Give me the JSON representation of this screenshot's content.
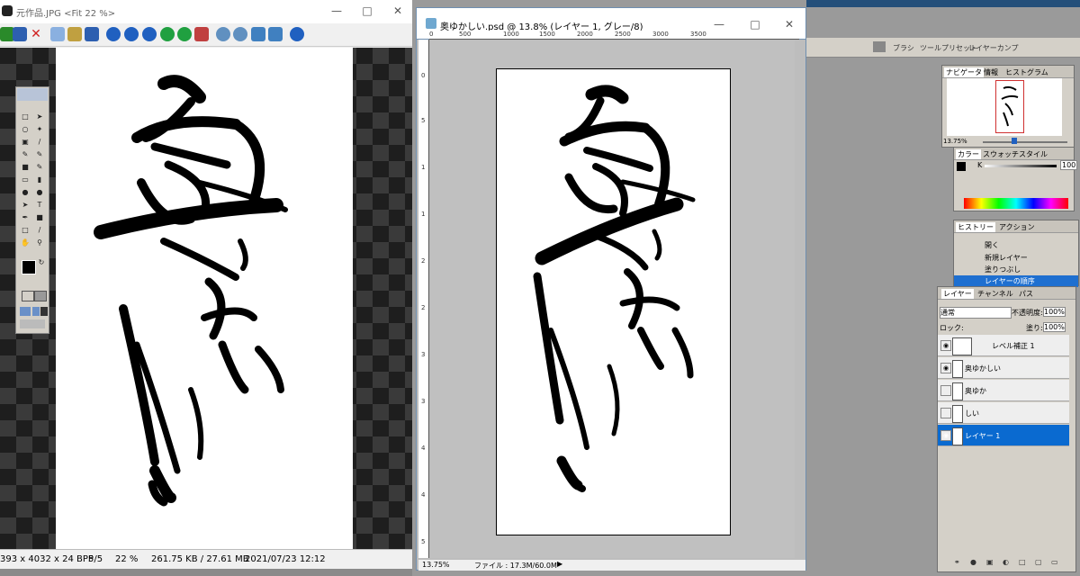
{
  "viewer": {
    "title": "元作品.JPG <Fit 22 %>",
    "status": {
      "dimensions": "393 x 4032 x 24 BPP",
      "index": "5/5",
      "zoom": "22 %",
      "size": "261.75 KB / 27.61 MB",
      "datetime": "2021/07/23 12:12"
    }
  },
  "document": {
    "title": "奥ゆかしい.psd @ 13.8% (レイヤー 1, グレー/8)",
    "ruler_top": [
      "0",
      "500",
      "1000",
      "1500",
      "2000",
      "2500",
      "3000",
      "3500"
    ],
    "ruler_left": [
      "0",
      "5",
      "1",
      "1",
      "2",
      "2",
      "3",
      "3",
      "4",
      "4",
      "5"
    ],
    "status_zoom": "13.75%",
    "status_file": "ファイル : 17.3M/60.0M"
  },
  "palettes": {
    "top_tabs": [
      "ブラシ",
      "ツールプリセット",
      "レイヤーカンプ"
    ],
    "navigator_tabs": [
      "ナビゲータ",
      "情報",
      "ヒストグラム"
    ],
    "navigator_zoom": "13.75%",
    "color_tabs": [
      "カラー",
      "スウォッチ",
      "スタイル"
    ],
    "color_channel": "K",
    "color_value": "100",
    "history_tabs": [
      "ヒストリー",
      "アクション"
    ],
    "history_items": [
      "開く",
      "新規レイヤー",
      "塗りつぶし",
      "レイヤーの順序"
    ],
    "layers_tabs": [
      "レイヤー",
      "チャンネル",
      "パス"
    ],
    "blend_mode": "通常",
    "opacity_label": "不透明度:",
    "opacity_value": "100%",
    "lock_label": "ロック:",
    "fill_label": "塗り:",
    "fill_value": "100%",
    "layers": [
      {
        "name": "レベル補正 1",
        "visible": true
      },
      {
        "name": "奥ゆかしい",
        "visible": true
      },
      {
        "name": "奥ゆか",
        "visible": false
      },
      {
        "name": "しい",
        "visible": false
      },
      {
        "name": "レイヤー 1",
        "visible": true,
        "selected": true
      }
    ]
  }
}
